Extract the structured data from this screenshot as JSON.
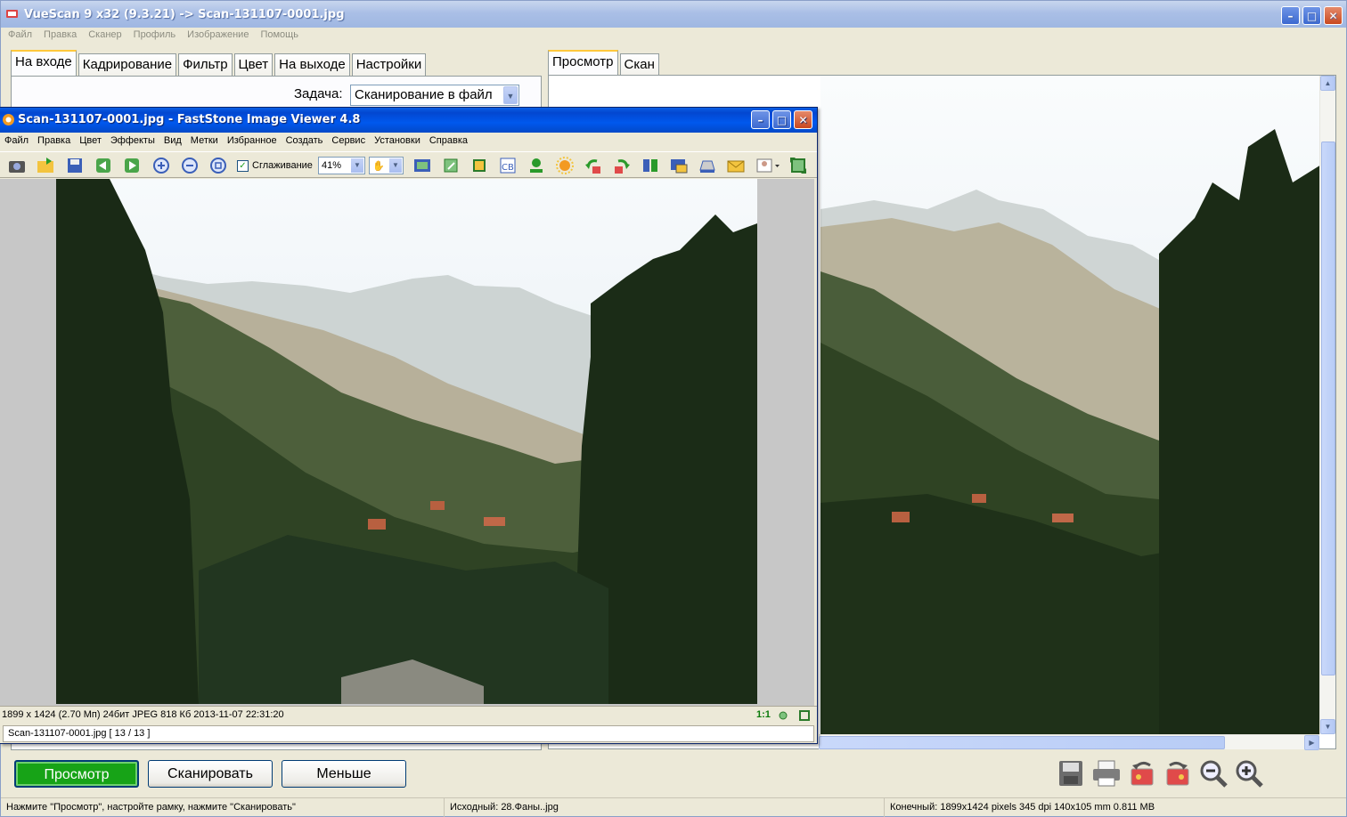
{
  "vuescan": {
    "title": "VueScan 9 x32 (9.3.21) -> Scan-131107-0001.jpg",
    "menu": [
      "Файл",
      "Правка",
      "Сканер",
      "Профиль",
      "Изображение",
      "Помощь"
    ],
    "left_tabs": [
      "На входе",
      "Кадрирование",
      "Фильтр",
      "Цвет",
      "На выходе",
      "Настройки"
    ],
    "active_left_tab": "На входе",
    "task_label": "Задача:",
    "task_value": "Сканирование в файл",
    "right_tabs": [
      "Просмотр",
      "Скан"
    ],
    "active_right_tab": "Просмотр",
    "buttons": {
      "preview": "Просмотр",
      "scan": "Сканировать",
      "less": "Меньше"
    },
    "toolbar_icons": [
      "save-icon",
      "print-icon",
      "rotate-left-icon",
      "rotate-right-icon",
      "zoom-out-icon",
      "zoom-in-icon"
    ],
    "status": {
      "hint": "Нажмите \"Просмотр\", настройте рамку, нажмите \"Сканировать\"",
      "source": "Исходный: 28.Фаны..jpg",
      "output": "Конечный: 1899x1424 pixels 345 dpi 140x105 mm 0.811 MB"
    }
  },
  "faststone": {
    "title": "Scan-131107-0001.jpg  -  FastStone Image Viewer 4.8",
    "menu": [
      "Файл",
      "Правка",
      "Цвет",
      "Эффекты",
      "Вид",
      "Метки",
      "Избранное",
      "Создать",
      "Сервис",
      "Установки",
      "Справка"
    ],
    "smoothing_label": "Сглаживание",
    "smoothing_checked": true,
    "zoom_value": "41%",
    "image_info": "1899 x 1424 (2.70 Mп)  24бит  JPEG   818 Кб   2013-11-07 22:31:20",
    "ratio_label": "1:1",
    "file_status": "Scan-131107-0001.jpg [ 13 / 13 ]"
  },
  "colors": {
    "xp_blue": "#0058ee",
    "green_button": "#17a317",
    "tab_highlight": "#ffc83c"
  }
}
